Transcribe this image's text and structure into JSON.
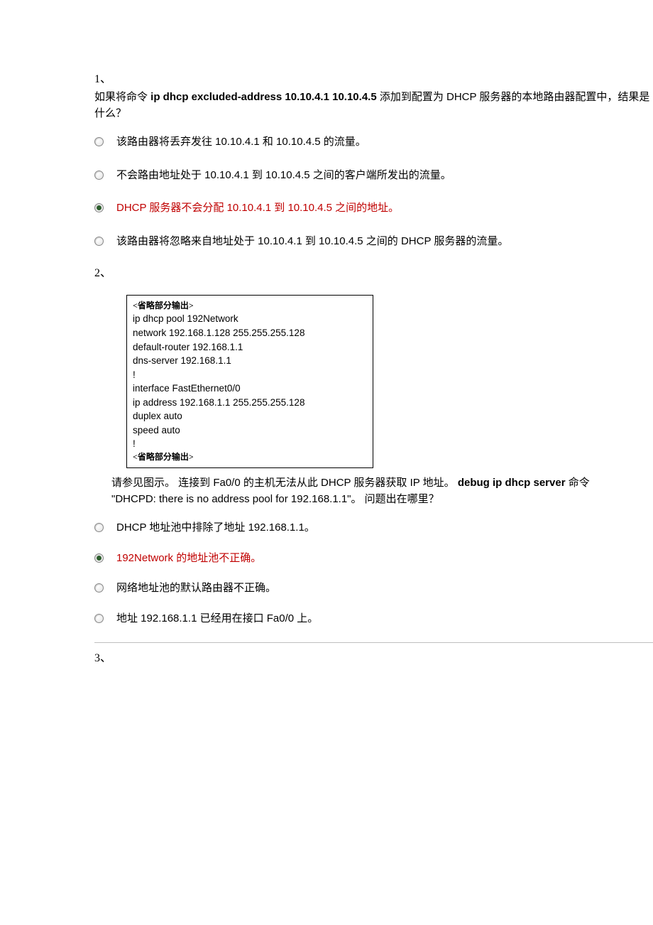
{
  "q1": {
    "number": "1、",
    "text_pre": "如果将命令 ",
    "text_cmd": "ip dhcp excluded-address 10.10.4.1 10.10.4.5",
    "text_post": " 添加到配置为 DHCP 服务器的本地路由器配置中，结果是什么？",
    "options": [
      {
        "label": "该路由器将丢弃发往 10.10.4.1 和 10.10.4.5 的流量。",
        "selected": false,
        "correct": false
      },
      {
        "label": "不会路由地址处于 10.10.4.1 到 10.10.4.5 之间的客户端所发出的流量。",
        "selected": false,
        "correct": false
      },
      {
        "label": "DHCP 服务器不会分配 10.10.4.1 到 10.10.4.5 之间的地址。",
        "selected": true,
        "correct": true
      },
      {
        "label": "该路由器将忽略来自地址处于 10.10.4.1 到 10.10.4.5 之间的 DHCP 服务器的流量。",
        "selected": false,
        "correct": false
      }
    ]
  },
  "q2": {
    "number": "2、",
    "exhibit": {
      "omit1": "<省略部分输出>",
      "l1": "ip dhcp pool 192Network",
      "l2": " network 192.168.1.128 255.255.255.128",
      "l3": " default-router 192.168.1.1",
      "l4": " dns-server 192.168.1.1",
      "bang1": "!",
      "l5": "interface FastEthernet0/0",
      "l6": " ip address 192.168.1.1 255.255.255.128",
      "l7": " duplex auto",
      "l8": " speed auto",
      "bang2": "!",
      "omit2": "<省略部分输出>"
    },
    "desc_pre": "请参见图示。 连接到 Fa0/0 的主机无法从此 DHCP 服务器获取 IP 地址。 ",
    "desc_cmd": "debug ip dhcp server",
    "desc_mid": " 命令",
    "desc_line2": "\"DHCPD: there is no address pool for 192.168.1.1\"。 问题出在哪里？",
    "options": [
      {
        "label": "DHCP 地址池中排除了地址 192.168.1.1。",
        "selected": false,
        "correct": false
      },
      {
        "label": "192Network 的地址池不正确。",
        "selected": true,
        "correct": true
      },
      {
        "label": "网络地址池的默认路由器不正确。",
        "selected": false,
        "correct": false
      },
      {
        "label": "地址 192.168.1.1 已经用在接口 Fa0/0 上。",
        "selected": false,
        "correct": false
      }
    ]
  },
  "q3": {
    "number": "3、"
  }
}
